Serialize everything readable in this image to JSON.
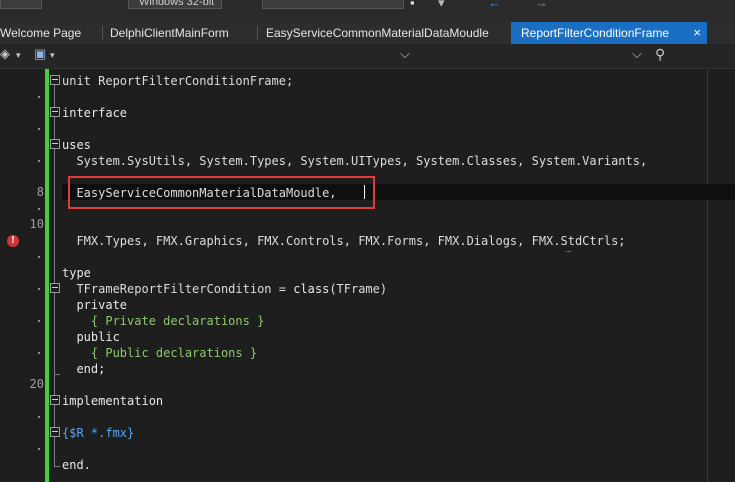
{
  "toolbar_top": {
    "platform_value": "Windows 32-bit"
  },
  "tabs": [
    {
      "label": "Welcome Page"
    },
    {
      "label": "DelphiClientMainForm"
    },
    {
      "label": "EasyServiceCommonMaterialDataMoudle"
    },
    {
      "label": "ReportFilterConditionFrame",
      "active": true
    }
  ],
  "icons": {
    "tab_close": "×",
    "dropdown": "⌵",
    "search": "⚲"
  },
  "gutter": {
    "line_numbers": [
      "8",
      "10",
      "20"
    ]
  },
  "code": {
    "line1": "unit ReportFilterConditionFrame;",
    "line3": "interface",
    "line5": "uses",
    "line6": "  System.SysUtils, System.Types, System.UITypes, System.Classes, System.Variants,",
    "line8": "  EasyServiceCommonMaterialDataMoudle,",
    "line11": "  FMX.Types, FMX.Graphics, FMX.Controls, FMX.Forms, FMX.Dialogs, FMX.StdCtrls;",
    "line13": "type",
    "line14_a": "  TFrameReportFilterCondition = ",
    "line14_b": "class",
    "line14_c": "(TFrame)",
    "line15": "  private",
    "line16": "    { Private declarations }",
    "line17": "  public",
    "line18": "    { Public declarations }",
    "line19": "  end;",
    "line21": "implementation",
    "line23": "{$R *.fmx}",
    "line25": "end."
  },
  "colors": {
    "active_tab": "#1a6fc2",
    "modified_bar": "#3fd23f",
    "highlight_box": "#e03c3c",
    "comment": "#8fc870",
    "directive": "#56a8f5",
    "error": "#d13438"
  }
}
